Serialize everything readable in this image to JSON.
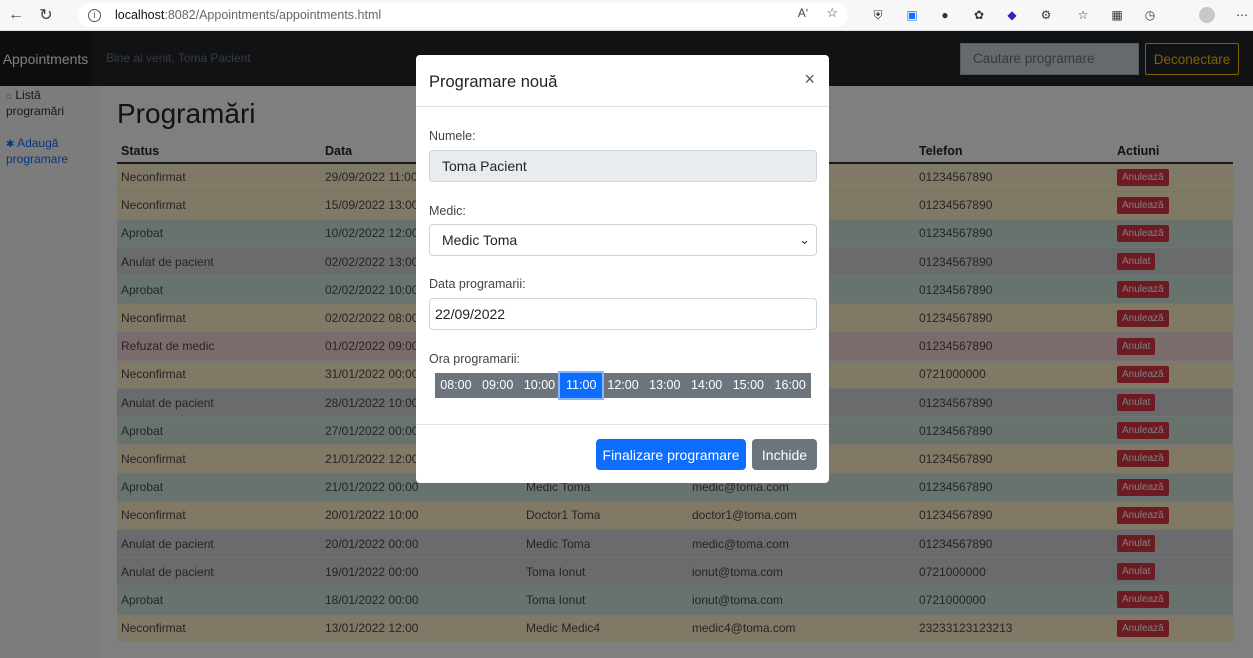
{
  "browser": {
    "url_host": "localhost",
    "url_path": ":8082/Appointments/appointments.html",
    "read_aloud": "Aʹ",
    "more": "⋯"
  },
  "nav": {
    "brand": "Appointments",
    "welcome": "Bine ai venit, Toma Pacient",
    "search_placeholder": "Cautare programare",
    "logout": "Deconectare"
  },
  "sidebar": {
    "items": [
      {
        "icon": "house-icon",
        "label": "Listă programări"
      },
      {
        "icon": "plus-circle-icon",
        "label": "Adaugă programare"
      }
    ]
  },
  "main": {
    "title": "Programări",
    "columns": [
      "Status",
      "Data",
      "",
      "",
      "Telefon",
      "Actiuni"
    ],
    "rows": [
      {
        "status": "Neconfirmat",
        "date": "29/09/2022 11:00",
        "medic": "",
        "email": "",
        "phone": "01234567890",
        "action": "Anulează",
        "kind": "neconf"
      },
      {
        "status": "Neconfirmat",
        "date": "15/09/2022 13:00",
        "medic": "",
        "email": "",
        "phone": "01234567890",
        "action": "Anulează",
        "kind": "neconf"
      },
      {
        "status": "Aprobat",
        "date": "10/02/2022 12:00",
        "medic": "",
        "email": "",
        "phone": "01234567890",
        "action": "Anulează",
        "kind": "aprob"
      },
      {
        "status": "Anulat de pacient",
        "date": "02/02/2022 13:00",
        "medic": "",
        "email": "",
        "phone": "01234567890",
        "action": "Anulat",
        "kind": "anulat"
      },
      {
        "status": "Aprobat",
        "date": "02/02/2022 10:00",
        "medic": "",
        "email": "",
        "phone": "01234567890",
        "action": "Anulează",
        "kind": "aprob"
      },
      {
        "status": "Neconfirmat",
        "date": "02/02/2022 08:00",
        "medic": "",
        "email": "",
        "phone": "01234567890",
        "action": "Anulează",
        "kind": "neconf"
      },
      {
        "status": "Refuzat de medic",
        "date": "01/02/2022 09:00",
        "medic": "",
        "email": "",
        "phone": "01234567890",
        "action": "Anulat",
        "kind": "refuz"
      },
      {
        "status": "Neconfirmat",
        "date": "31/01/2022 00:00",
        "medic": "",
        "email": "",
        "phone": "0721000000",
        "action": "Anulează",
        "kind": "neconf"
      },
      {
        "status": "Anulat de pacient",
        "date": "28/01/2022 10:00",
        "medic": "",
        "email": "",
        "phone": "01234567890",
        "action": "Anulat",
        "kind": "anulat"
      },
      {
        "status": "Aprobat",
        "date": "27/01/2022 00:00",
        "medic": "",
        "email": "",
        "phone": "01234567890",
        "action": "Anulează",
        "kind": "aprob"
      },
      {
        "status": "Neconfirmat",
        "date": "21/01/2022 12:00",
        "medic": "",
        "email": "",
        "phone": "01234567890",
        "action": "Anulează",
        "kind": "neconf"
      },
      {
        "status": "Aprobat",
        "date": "21/01/2022 00:00",
        "medic": "Medic Toma",
        "email": "medic@toma.com",
        "phone": "01234567890",
        "action": "Anulează",
        "kind": "aprob"
      },
      {
        "status": "Neconfirmat",
        "date": "20/01/2022 10:00",
        "medic": "Doctor1 Toma",
        "email": "doctor1@toma.com",
        "phone": "01234567890",
        "action": "Anulează",
        "kind": "neconf"
      },
      {
        "status": "Anulat de pacient",
        "date": "20/01/2022 00:00",
        "medic": "Medic Toma",
        "email": "medic@toma.com",
        "phone": "01234567890",
        "action": "Anulat",
        "kind": "anulat"
      },
      {
        "status": "Anulat de pacient",
        "date": "19/01/2022 00:00",
        "medic": "Toma Ionut",
        "email": "ionut@toma.com",
        "phone": "0721000000",
        "action": "Anulat",
        "kind": "anulat"
      },
      {
        "status": "Aprobat",
        "date": "18/01/2022 00:00",
        "medic": "Toma Ionut",
        "email": "ionut@toma.com",
        "phone": "0721000000",
        "action": "Anulează",
        "kind": "aprob"
      },
      {
        "status": "Neconfirmat",
        "date": "13/01/2022 12:00",
        "medic": "Medic Medic4",
        "email": "medic4@toma.com",
        "phone": "23233123123213",
        "action": "Anulează",
        "kind": "neconf"
      }
    ]
  },
  "modal": {
    "title": "Programare nouă",
    "close": "×",
    "name_label": "Numele:",
    "name_value": "Toma Pacient",
    "medic_label": "Medic:",
    "medic_value": "Medic Toma",
    "date_label": "Data programarii:",
    "date_value": "22/09/2022",
    "time_label": "Ora programarii:",
    "times": [
      "08:00",
      "09:00",
      "10:00",
      "11:00",
      "12:00",
      "13:00",
      "14:00",
      "15:00",
      "16:00"
    ],
    "selected_time": "11:00",
    "submit": "Finalizare programare",
    "cancel": "Inchide"
  }
}
